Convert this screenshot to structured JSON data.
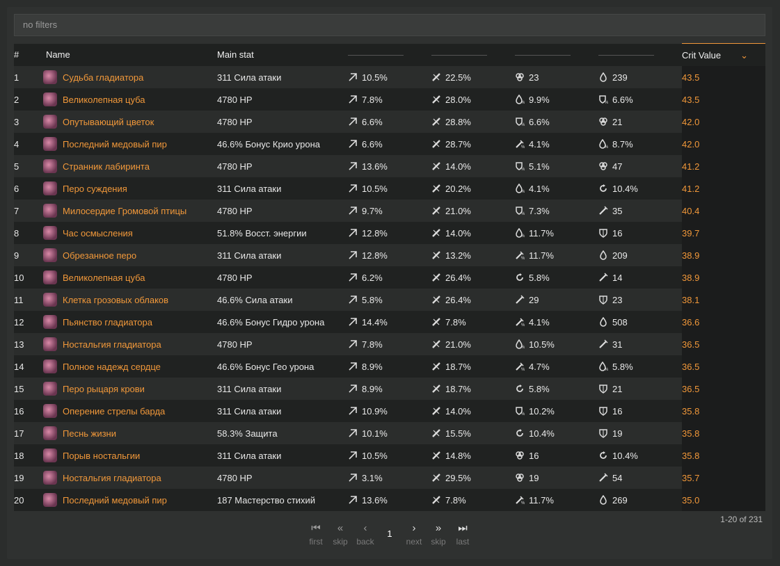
{
  "filter": {
    "placeholder": "no filters"
  },
  "columns": {
    "index": "#",
    "name": "Name",
    "main_stat": "Main stat",
    "crit_value": "Crit Value"
  },
  "rows": [
    {
      "idx": "1",
      "name": "Судьба гладиатора",
      "main": "311 Сила атаки",
      "s1": "10.5%",
      "s2": "22.5%",
      "s3": "23",
      "s4": "239",
      "i1": "crit-rate-icon",
      "i2": "crit-dmg-icon",
      "i3": "def-icon",
      "i4": "hp-icon",
      "cv": "43.5"
    },
    {
      "idx": "2",
      "name": "Великолепная цуба",
      "main": "4780 HP",
      "s1": "7.8%",
      "s2": "28.0%",
      "s3": "9.9%",
      "s4": "6.6%",
      "i1": "crit-rate-icon",
      "i2": "crit-dmg-icon",
      "i3": "hp-percent-icon",
      "i4": "def-percent-icon",
      "cv": "43.5"
    },
    {
      "idx": "3",
      "name": "Опутывающий цветок",
      "main": "4780 HP",
      "s1": "6.6%",
      "s2": "28.8%",
      "s3": "6.6%",
      "s4": "21",
      "i1": "crit-rate-icon",
      "i2": "crit-dmg-icon",
      "i3": "def-percent-icon",
      "i4": "def-icon",
      "cv": "42.0"
    },
    {
      "idx": "4",
      "name": "Последний медовый пир",
      "main": "46.6% Бонус Крио урона",
      "s1": "6.6%",
      "s2": "28.7%",
      "s3": "4.1%",
      "s4": "8.7%",
      "i1": "crit-rate-icon",
      "i2": "crit-dmg-icon",
      "i3": "atk-percent-icon",
      "i4": "hp-percent-icon",
      "cv": "42.0"
    },
    {
      "idx": "5",
      "name": "Странник лабиринта",
      "main": "4780 HP",
      "s1": "13.6%",
      "s2": "14.0%",
      "s3": "5.1%",
      "s4": "47",
      "i1": "crit-rate-icon",
      "i2": "crit-dmg-icon",
      "i3": "def-percent-icon",
      "i4": "def-icon",
      "cv": "41.2"
    },
    {
      "idx": "6",
      "name": "Перо суждения",
      "main": "311 Сила атаки",
      "s1": "10.5%",
      "s2": "20.2%",
      "s3": "4.1%",
      "s4": "10.4%",
      "i1": "crit-rate-icon",
      "i2": "crit-dmg-icon",
      "i3": "hp-percent-icon",
      "i4": "recharge-icon",
      "cv": "41.2"
    },
    {
      "idx": "7",
      "name": "Милосердие Громовой птицы",
      "main": "4780 HP",
      "s1": "9.7%",
      "s2": "21.0%",
      "s3": "7.3%",
      "s4": "35",
      "i1": "crit-rate-icon",
      "i2": "crit-dmg-icon",
      "i3": "def-percent-icon",
      "i4": "atk-icon",
      "cv": "40.4"
    },
    {
      "idx": "8",
      "name": "Час осмысления",
      "main": "51.8% Восст. энергии",
      "s1": "12.8%",
      "s2": "14.0%",
      "s3": "11.7%",
      "s4": "16",
      "i1": "crit-rate-icon",
      "i2": "crit-dmg-icon",
      "i3": "hp-percent-icon",
      "i4": "shield-icon",
      "cv": "39.7"
    },
    {
      "idx": "9",
      "name": "Обрезанное перо",
      "main": "311 Сила атаки",
      "s1": "12.8%",
      "s2": "13.2%",
      "s3": "11.7%",
      "s4": "209",
      "i1": "crit-rate-icon",
      "i2": "crit-dmg-icon",
      "i3": "atk-percent-icon",
      "i4": "hp-icon",
      "cv": "38.9"
    },
    {
      "idx": "10",
      "name": "Великолепная цуба",
      "main": "4780 HP",
      "s1": "6.2%",
      "s2": "26.4%",
      "s3": "5.8%",
      "s4": "14",
      "i1": "crit-rate-icon",
      "i2": "crit-dmg-icon",
      "i3": "recharge-icon",
      "i4": "atk-icon",
      "cv": "38.9"
    },
    {
      "idx": "11",
      "name": "Клетка грозовых облаков",
      "main": "46.6% Сила атаки",
      "s1": "5.8%",
      "s2": "26.4%",
      "s3": "29",
      "s4": "23",
      "i1": "crit-rate-icon",
      "i2": "crit-dmg-icon",
      "i3": "atk-icon",
      "i4": "shield-icon",
      "cv": "38.1"
    },
    {
      "idx": "12",
      "name": "Пьянство гладиатора",
      "main": "46.6% Бонус Гидро урона",
      "s1": "14.4%",
      "s2": "7.8%",
      "s3": "4.1%",
      "s4": "508",
      "i1": "crit-rate-icon",
      "i2": "crit-dmg-icon",
      "i3": "atk-percent-icon",
      "i4": "hp-icon",
      "cv": "36.6"
    },
    {
      "idx": "13",
      "name": "Ностальгия гладиатора",
      "main": "4780 HP",
      "s1": "7.8%",
      "s2": "21.0%",
      "s3": "10.5%",
      "s4": "31",
      "i1": "crit-rate-icon",
      "i2": "crit-dmg-icon",
      "i3": "hp-percent-icon",
      "i4": "atk-icon",
      "cv": "36.5"
    },
    {
      "idx": "14",
      "name": "Полное надежд сердце",
      "main": "46.6% Бонус Гео урона",
      "s1": "8.9%",
      "s2": "18.7%",
      "s3": "4.7%",
      "s4": "5.8%",
      "i1": "crit-rate-icon",
      "i2": "crit-dmg-icon",
      "i3": "atk-percent-icon",
      "i4": "hp-percent-icon",
      "cv": "36.5"
    },
    {
      "idx": "15",
      "name": "Перо рыцаря крови",
      "main": "311 Сила атаки",
      "s1": "8.9%",
      "s2": "18.7%",
      "s3": "5.8%",
      "s4": "21",
      "i1": "crit-rate-icon",
      "i2": "crit-dmg-icon",
      "i3": "recharge-icon",
      "i4": "shield-icon",
      "cv": "36.5"
    },
    {
      "idx": "16",
      "name": "Оперение стрелы барда",
      "main": "311 Сила атаки",
      "s1": "10.9%",
      "s2": "14.0%",
      "s3": "10.2%",
      "s4": "16",
      "i1": "crit-rate-icon",
      "i2": "crit-dmg-icon",
      "i3": "def-percent-icon",
      "i4": "shield-icon",
      "cv": "35.8"
    },
    {
      "idx": "17",
      "name": "Песнь жизни",
      "main": "58.3% Защита",
      "s1": "10.1%",
      "s2": "15.5%",
      "s3": "10.4%",
      "s4": "19",
      "i1": "crit-rate-icon",
      "i2": "crit-dmg-icon",
      "i3": "recharge-icon",
      "i4": "shield-icon",
      "cv": "35.8"
    },
    {
      "idx": "18",
      "name": "Порыв ностальгии",
      "main": "311 Сила атаки",
      "s1": "10.5%",
      "s2": "14.8%",
      "s3": "16",
      "s4": "10.4%",
      "i1": "crit-rate-icon",
      "i2": "crit-dmg-icon",
      "i3": "def-icon",
      "i4": "recharge-icon",
      "cv": "35.8"
    },
    {
      "idx": "19",
      "name": "Ностальгия гладиатора",
      "main": "4780 HP",
      "s1": "3.1%",
      "s2": "29.5%",
      "s3": "19",
      "s4": "54",
      "i1": "crit-rate-icon",
      "i2": "crit-dmg-icon",
      "i3": "def-icon",
      "i4": "atk-icon",
      "cv": "35.7"
    },
    {
      "idx": "20",
      "name": "Последний медовый пир",
      "main": "187 Мастерство стихий",
      "s1": "13.6%",
      "s2": "7.8%",
      "s3": "11.7%",
      "s4": "269",
      "i1": "crit-rate-icon",
      "i2": "crit-dmg-icon",
      "i3": "atk-percent-icon",
      "i4": "hp-icon",
      "cv": "35.0"
    }
  ],
  "pagination": {
    "first": "first",
    "skip_back": "skip",
    "back": "back",
    "current": "1",
    "next": "next",
    "skip_forward": "skip",
    "last": "last",
    "range": "1-20 of 231"
  },
  "colors": {
    "accent": "#f1983a",
    "bg": "#2b2d2c",
    "row_alt": "#202221"
  }
}
